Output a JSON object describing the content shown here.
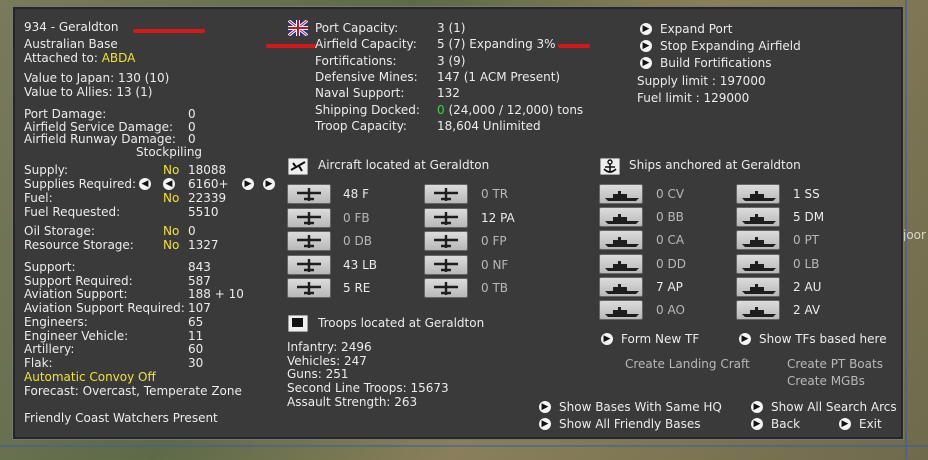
{
  "base": {
    "title": "934 - Geraldton",
    "type": "Australian Base",
    "attached_label": "Attached to:",
    "attached_value": "ABDA",
    "value_japan": "Value to Japan: 130 (10)",
    "value_allies": "Value to Allies: 13 (1)"
  },
  "damage": [
    {
      "label": "Port Damage:",
      "value": "0"
    },
    {
      "label": "Airfield Service Damage:",
      "value": "0"
    },
    {
      "label": "Airfield Runway Damage:",
      "value": "0"
    }
  ],
  "stockpiling_label": "Stockpiling",
  "supply": [
    {
      "label": "Supply:",
      "flag": "No",
      "value": "18088"
    },
    {
      "label": "Supplies Required:",
      "flag": "",
      "value": "6160+"
    },
    {
      "label": "Fuel:",
      "flag": "No",
      "value": "22339"
    },
    {
      "label": "Fuel Requested:",
      "flag": "",
      "value": "5510"
    },
    {
      "label": "Oil Storage:",
      "flag": "No",
      "value": "0"
    },
    {
      "label": "Resource Storage:",
      "flag": "No",
      "value": "1327"
    }
  ],
  "support": [
    {
      "label": "Support:",
      "value": "843"
    },
    {
      "label": "Support Required:",
      "value": "587"
    },
    {
      "label": "Aviation Support:",
      "value": "188 + 10"
    },
    {
      "label": "Aviation Support Required:",
      "value": "107"
    },
    {
      "label": "Engineers:",
      "value": "65"
    },
    {
      "label": "Engineer Vehicle:",
      "value": "11"
    },
    {
      "label": "Artillery:",
      "value": "60"
    },
    {
      "label": "Flak:",
      "value": "30"
    }
  ],
  "convoy": "Automatic Convoy Off",
  "forecast": "Forecast: Overcast, Temperate Zone",
  "coast_watchers": "Friendly Coast Watchers Present",
  "port": [
    {
      "label": "Port Capacity:",
      "value": "3 (1)"
    },
    {
      "label": "Airfield Capacity:",
      "value": "5 (7) Expanding 3%"
    },
    {
      "label": "Fortifications:",
      "value": "3 (9)"
    },
    {
      "label": "Defensive Mines:",
      "value": "147 (1 ACM Present)"
    },
    {
      "label": "Naval Support:",
      "value": "132"
    },
    {
      "label": "Shipping Docked:",
      "value_green": "0",
      "value": " (24,000 / 12,000) tons"
    },
    {
      "label": "Troop Capacity:",
      "value": "18,604   Unlimited"
    }
  ],
  "actions": {
    "expand_port": "Expand Port",
    "stop_airfield": "Stop Expanding Airfield",
    "build_fort": "Build Fortifications",
    "supply_limit": "Supply limit : 197000",
    "fuel_limit": "Fuel limit : 129000"
  },
  "aircraft": {
    "header": "Aircraft located at Geraldton",
    "left": [
      {
        "count": "48 F",
        "active": true
      },
      {
        "count": "0 FB",
        "active": false
      },
      {
        "count": "0 DB",
        "active": false
      },
      {
        "count": "43 LB",
        "active": true
      },
      {
        "count": "5 RE",
        "active": true
      }
    ],
    "right": [
      {
        "count": "0 TR",
        "active": false
      },
      {
        "count": "12 PA",
        "active": true
      },
      {
        "count": "0 FP",
        "active": false
      },
      {
        "count": "0 NF",
        "active": false
      },
      {
        "count": "0 TB",
        "active": false
      }
    ]
  },
  "ships": {
    "header": "Ships anchored at Geraldton",
    "left": [
      {
        "count": "0 CV",
        "active": false
      },
      {
        "count": "0 BB",
        "active": false
      },
      {
        "count": "0 CA",
        "active": false
      },
      {
        "count": "0 DD",
        "active": false
      },
      {
        "count": "7 AP",
        "active": true
      },
      {
        "count": "0 AO",
        "active": false
      }
    ],
    "right": [
      {
        "count": "1 SS",
        "active": true
      },
      {
        "count": "5 DM",
        "active": true
      },
      {
        "count": "0 PT",
        "active": false
      },
      {
        "count": "0 LB",
        "active": false
      },
      {
        "count": "2 AU",
        "active": true
      },
      {
        "count": "2 AV",
        "active": true
      }
    ],
    "form_tf": "Form New TF",
    "show_tfs": "Show TFs based here",
    "create_landing": "Create Landing Craft",
    "create_pt": "Create PT Boats",
    "create_mgb": "Create MGBs"
  },
  "troops": {
    "header": "Troops located at Geraldton",
    "lines": [
      "Infantry: 2496",
      "Vehicles: 247",
      "Guns: 251",
      "Second Line Troops: 15673",
      "Assault Strength: 263"
    ]
  },
  "bottom": {
    "same_hq": "Show Bases With Same HQ",
    "friendly": "Show All Friendly Bases",
    "search_arcs": "Show All Search Arcs",
    "back": "Back",
    "exit": "Exit"
  },
  "map_label": "joor"
}
